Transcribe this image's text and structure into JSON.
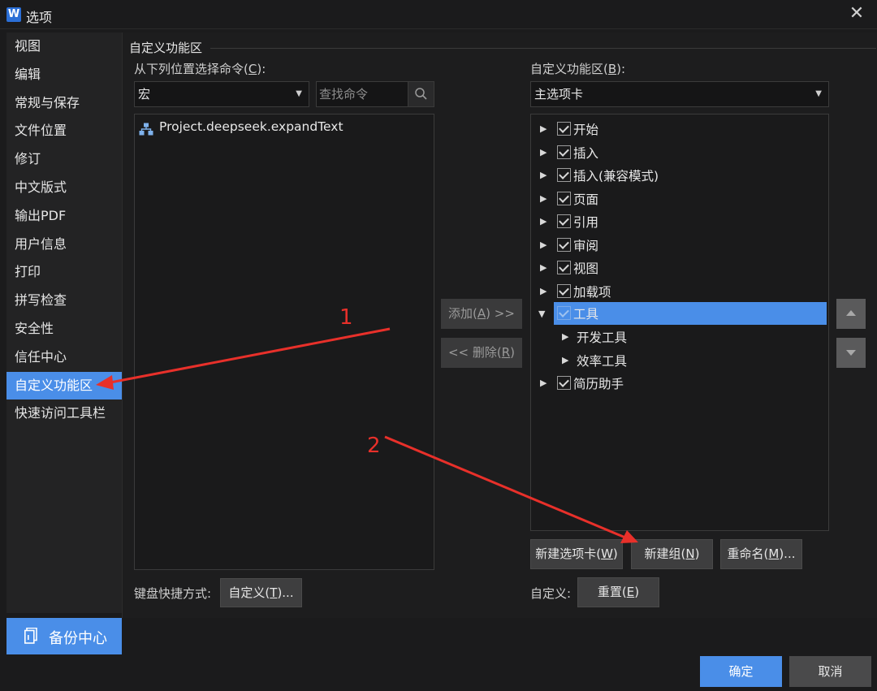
{
  "window": {
    "title": "选项",
    "app_logo_letter": "W"
  },
  "sidebar": {
    "items": [
      {
        "label": "视图"
      },
      {
        "label": "编辑"
      },
      {
        "label": "常规与保存"
      },
      {
        "label": "文件位置"
      },
      {
        "label": "修订"
      },
      {
        "label": "中文版式"
      },
      {
        "label": "输出PDF"
      },
      {
        "label": "用户信息"
      },
      {
        "label": "打印"
      },
      {
        "label": "拼写检查"
      },
      {
        "label": "安全性"
      },
      {
        "label": "信任中心"
      },
      {
        "label": "自定义功能区",
        "active": true
      },
      {
        "label": "快速访问工具栏"
      }
    ],
    "backup_label": "备份中心"
  },
  "main": {
    "section_title": "自定义功能区",
    "left": {
      "label_prefix": "从下列位置选择命令(",
      "label_key": "C",
      "label_suffix": "):",
      "source_select": "宏",
      "search_placeholder": "查找命令",
      "commands": [
        {
          "label": "Project.deepseek.expandText",
          "icon": "macro-icon"
        }
      ]
    },
    "middle": {
      "add_prefix": "添加(",
      "add_key": "A",
      "add_suffix": ") >>",
      "remove_prefix": "<< 删除(",
      "remove_key": "R",
      "remove_suffix": ")"
    },
    "right": {
      "label_prefix": "自定义功能区(",
      "label_key": "B",
      "label_suffix": "):",
      "ribbon_select": "主选项卡",
      "tree": [
        {
          "label": "开始",
          "checked": true
        },
        {
          "label": "插入",
          "checked": true
        },
        {
          "label": "插入(兼容模式)",
          "checked": true
        },
        {
          "label": "页面",
          "checked": true
        },
        {
          "label": "引用",
          "checked": true
        },
        {
          "label": "审阅",
          "checked": true
        },
        {
          "label": "视图",
          "checked": true
        },
        {
          "label": "加载项",
          "checked": true
        },
        {
          "label": "工具",
          "checked": true,
          "expanded": true,
          "selected": true
        },
        {
          "label": "开发工具",
          "child": true
        },
        {
          "label": "效率工具",
          "child": true
        },
        {
          "label": "简历助手",
          "checked": true
        }
      ],
      "new_tab_prefix": "新建选项卡(",
      "new_tab_key": "W",
      "new_tab_suffix": ")",
      "new_group_prefix": "新建组(",
      "new_group_key": "N",
      "new_group_suffix": ")",
      "rename_prefix": "重命名(",
      "rename_key": "M",
      "rename_suffix": ")...",
      "customize_label": "自定义:",
      "reset_prefix": "重置(",
      "reset_key": "E",
      "reset_suffix": ")"
    },
    "keyboard": {
      "label": "键盘快捷方式:",
      "btn_prefix": "自定义(",
      "btn_key": "T",
      "btn_suffix": ")..."
    }
  },
  "footer": {
    "ok": "确定",
    "cancel": "取消"
  },
  "annotations": {
    "marker_1": "1",
    "marker_2": "2",
    "color": "#e8302a"
  }
}
